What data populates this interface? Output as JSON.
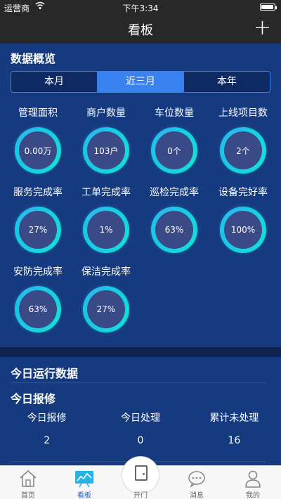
{
  "status_bar": {
    "carrier": "运营商",
    "time": "下午3:34",
    "battery_level": 0.95
  },
  "nav": {
    "title": "看板",
    "add_label": "+"
  },
  "overview": {
    "title": "数据概览",
    "segments": [
      "本月",
      "近三月",
      "本年"
    ],
    "active_segment": "近三月",
    "metrics": [
      {
        "label": "管理面积",
        "value": "0.00万"
      },
      {
        "label": "商户数量",
        "value": "103户"
      },
      {
        "label": "车位数量",
        "value": "0个"
      },
      {
        "label": "上线项目数",
        "value": "2个"
      },
      {
        "label": "服务完成率",
        "value": "27%"
      },
      {
        "label": "工单完成率",
        "value": "1%"
      },
      {
        "label": "巡检完成率",
        "value": "63%"
      },
      {
        "label": "设备完好率",
        "value": "100%"
      },
      {
        "label": "安防完成率",
        "value": "63%"
      },
      {
        "label": "保洁完成率",
        "value": "27%"
      }
    ]
  },
  "today_run": {
    "title": "今日运行数据"
  },
  "today_repair": {
    "title": "今日报修",
    "columns": [
      {
        "header": "今日报修",
        "value": "2"
      },
      {
        "header": "今日处理",
        "value": "0"
      },
      {
        "header": "累计未处理",
        "value": "16"
      }
    ]
  },
  "tab_bar": {
    "tabs": [
      {
        "label": "首页",
        "icon": "home-icon"
      },
      {
        "label": "看板",
        "icon": "dashboard-icon"
      },
      {
        "label": "开门",
        "icon": "door-icon"
      },
      {
        "label": "消息",
        "icon": "message-icon"
      },
      {
        "label": "我的",
        "icon": "user-icon"
      }
    ],
    "active_tab": "看板",
    "active_color": "#2a5fb8"
  },
  "colors": {
    "background": "#163a7f",
    "accent": "#3a82f0",
    "ring": "#12e0d8",
    "header": "#282828"
  }
}
